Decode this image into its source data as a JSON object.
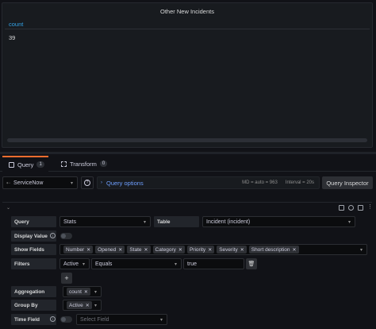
{
  "panel": {
    "title": "Other New Incidents",
    "column_header": "count",
    "rows": [
      "39"
    ]
  },
  "tabs": [
    {
      "label": "Query",
      "count": "1"
    },
    {
      "label": "Transform",
      "count": "0"
    }
  ],
  "query_bar": {
    "datasource": "ServiceNow",
    "options_label": "Query options",
    "md": "MD = auto = 963",
    "interval": "Interval = 20s",
    "inspector_label": "Query Inspector"
  },
  "editor": {
    "query_label": "Query",
    "query_value": "Stats",
    "table_label": "Table",
    "table_value": "Incident (incident)",
    "display_value_label": "Display Value",
    "show_fields_label": "Show Fields",
    "show_fields": [
      "Number",
      "Opened",
      "State",
      "Category",
      "Priority",
      "Severity",
      "Short description"
    ],
    "filters_label": "Filters",
    "filter_field": "Active",
    "filter_op": "Equals",
    "filter_value": "true",
    "add_label": "+",
    "aggregation_label": "Aggregation",
    "aggregation_chips": [
      "count"
    ],
    "group_by_label": "Group By",
    "group_by_chips": [
      "Active"
    ],
    "time_field_label": "Time Field",
    "time_field_placeholder": "Select Field"
  },
  "colors": {
    "accent": "#33a2e5",
    "tab_active": "#f56d2f",
    "link": "#6e9fff"
  }
}
